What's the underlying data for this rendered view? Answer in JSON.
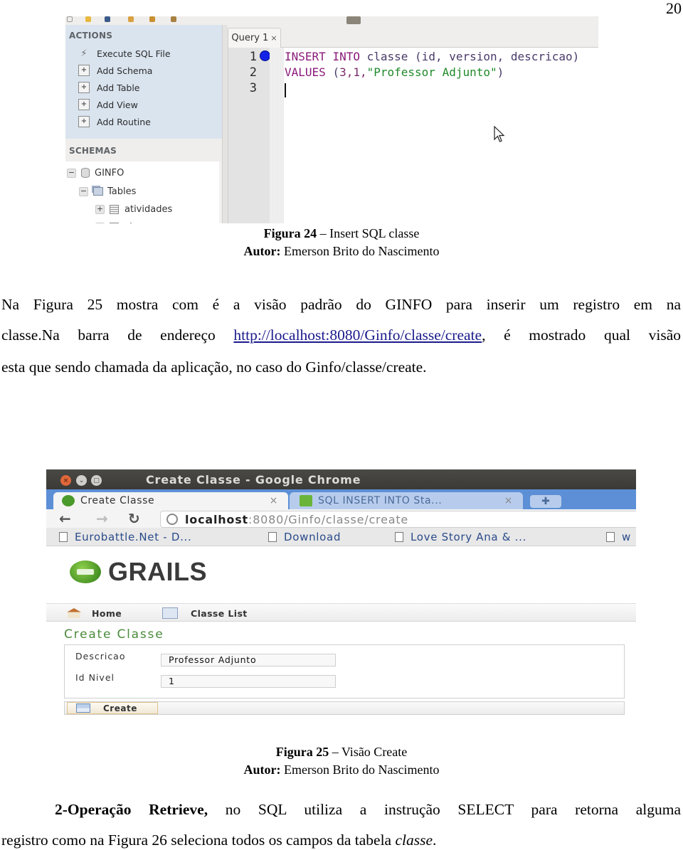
{
  "page_number": "20",
  "figure24": {
    "workbench": {
      "actions_title": "ACTIONS",
      "actions": [
        {
          "label": "Execute SQL File",
          "icon": "lightning-icon"
        },
        {
          "label": "Add Schema",
          "icon": "add-schema-icon"
        },
        {
          "label": "Add Table",
          "icon": "add-table-icon"
        },
        {
          "label": "Add View",
          "icon": "add-view-icon"
        },
        {
          "label": "Add Routine",
          "icon": "add-routine-icon"
        }
      ],
      "schemas_title": "SCHEMAS",
      "tree": {
        "schema": {
          "label": "GINFO",
          "toggle": "−"
        },
        "tables": {
          "label": "Tables",
          "toggle": "−"
        },
        "items": [
          {
            "label": "atividades",
            "toggle": "+"
          },
          {
            "label": "classe",
            "toggle": "−"
          }
        ]
      },
      "query_tab": {
        "label": "Query 1",
        "close": "×"
      },
      "line_numbers": [
        "1",
        "2",
        "3"
      ],
      "code": {
        "line1": {
          "kw1": "INSERT",
          "kw2": "INTO",
          "table": "classe",
          "cols": "(id, version, descricao)"
        },
        "line2": {
          "kw": "VALUES",
          "open": "(",
          "nums": "3,1,",
          "str": "\"Professor Adjunto\"",
          "close": ")"
        }
      }
    },
    "caption": {
      "label": "Figura 24",
      "title": "– Insert SQL classe",
      "author_label": "Autor:",
      "author": "Emerson Brito do Nascimento"
    }
  },
  "paragraph1": {
    "line1": "Na Figura 25 mostra com é a visão padrão do GINFO para inserir um registro em na",
    "line2_pre": "classe.Na barra de endereço ",
    "link": "http://localhost:8080/Ginfo/classe/create",
    "line2_post": ", é mostrado qual visão",
    "line3": "esta que sendo chamada da aplicação, no caso do Ginfo/classe/create."
  },
  "figure25": {
    "browser": {
      "window_title": "Create Classe - Google Chrome",
      "window_buttons": {
        "close": "×",
        "minimize": "⌄",
        "maximize": "□"
      },
      "tabs": [
        {
          "label": "Create Classe",
          "close": "×",
          "active": true
        },
        {
          "label": "SQL INSERT INTO Sta...",
          "close": "×",
          "active": false
        }
      ],
      "new_tab": "✚",
      "nav": {
        "back": "←",
        "forward": "→",
        "reload": "↻"
      },
      "address": {
        "host": "localhost",
        "rest": ":8080/Ginfo/classe/create"
      },
      "bookmarks": [
        "Eurobattle.Net - D...",
        "Download",
        "Love Story Ana & ...",
        "w"
      ]
    },
    "app": {
      "logo_text": "GRAILS",
      "nav": [
        {
          "label": "Home",
          "icon": "home-icon"
        },
        {
          "label": "Classe List",
          "icon": "list-icon"
        }
      ],
      "title": "Create Classe",
      "fields": [
        {
          "label": "Descricao",
          "value": "Professor Adjunto"
        },
        {
          "label": "Id Nivel",
          "value": "1"
        }
      ],
      "create_button": "Create"
    },
    "caption": {
      "label": "Figura 25",
      "title": "– Visão Create",
      "author_label": "Autor:",
      "author": "Emerson Brito do Nascimento"
    }
  },
  "paragraph2": {
    "bold": "2-Operação Retrieve,",
    "line1_rest": " no SQL utiliza a instrução SELECT para retorna alguma",
    "line2_pre": "registro como na Figura 26 seleciona todos os campos da tabela ",
    "italic": "classe",
    "line2_post": "."
  }
}
